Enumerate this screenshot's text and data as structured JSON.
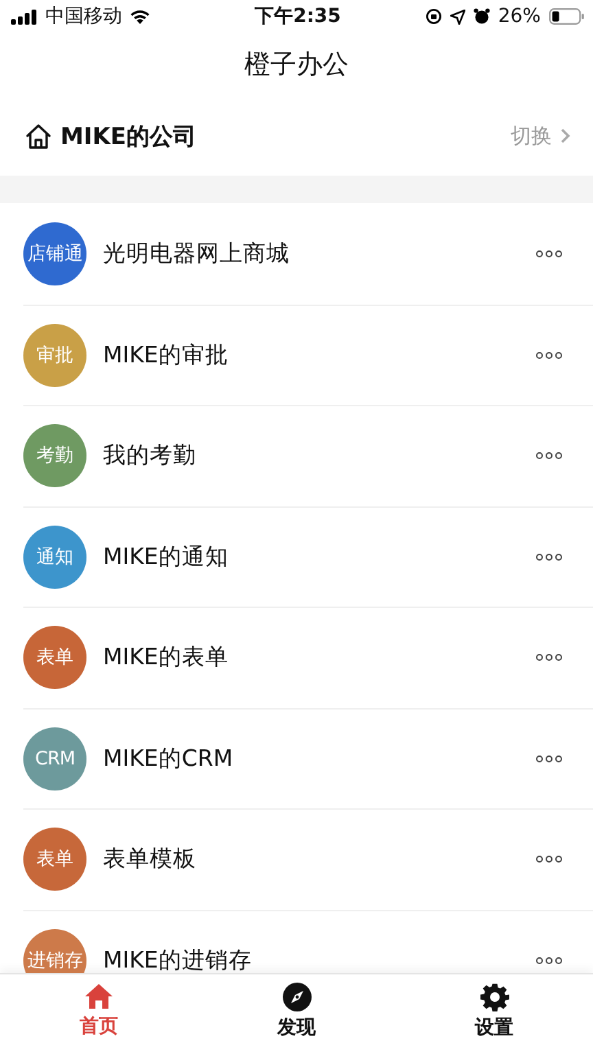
{
  "status_bar": {
    "carrier": "中国移动",
    "time": "下午2:35",
    "battery": "26%"
  },
  "title": "橙子办公",
  "company": {
    "name": "MIKE的公司",
    "action": "切换"
  },
  "apps": [
    {
      "badge": "店铺通",
      "name": "光明电器网上商城",
      "color": "#2f6ad0"
    },
    {
      "badge": "审批",
      "name": "MIKE的审批",
      "color": "#c9a047"
    },
    {
      "badge": "考勤",
      "name": "我的考勤",
      "color": "#6f9a62"
    },
    {
      "badge": "通知",
      "name": "MIKE的通知",
      "color": "#3d95cc"
    },
    {
      "badge": "表单",
      "name": "MIKE的表单",
      "color": "#c76638"
    },
    {
      "badge": "CRM",
      "name": "MIKE的CRM",
      "color": "#6d9a9c"
    },
    {
      "badge": "表单",
      "name": "表单模板",
      "color": "#c7683a"
    },
    {
      "badge": "进销存",
      "name": "MIKE的进销存",
      "color": "#cd7a4a"
    }
  ],
  "tabs": [
    {
      "kind": "home",
      "label": "首页",
      "selected": true
    },
    {
      "kind": "discover",
      "label": "发现",
      "selected": false
    },
    {
      "kind": "settings",
      "label": "设置",
      "selected": false
    }
  ]
}
